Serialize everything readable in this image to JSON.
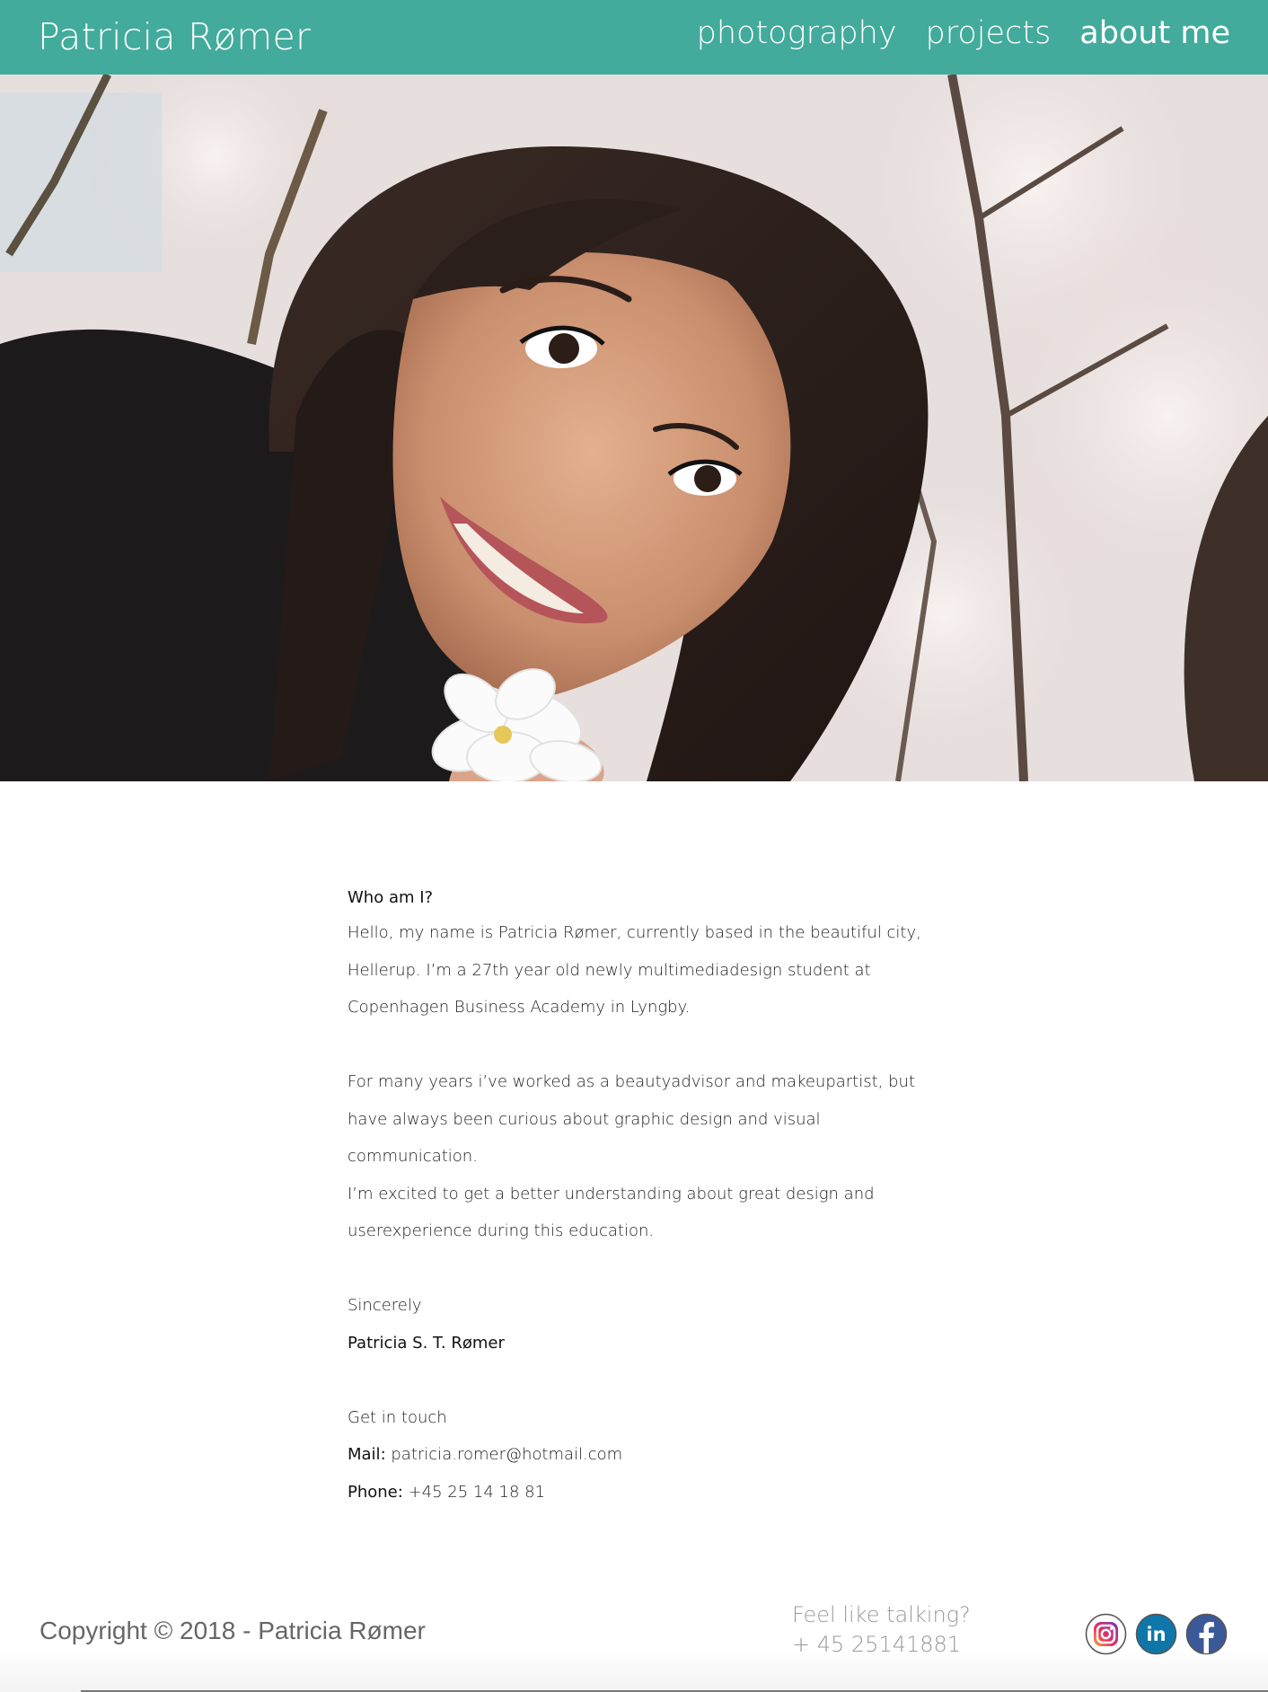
{
  "header": {
    "brand": "Patricia Rømer",
    "nav": [
      {
        "label": "photography",
        "active": false
      },
      {
        "label": "projects",
        "active": false
      },
      {
        "label": "about me",
        "active": true
      }
    ]
  },
  "hero": {
    "image": "portrait photo of smiling woman holding white cherry blossom under blooming trees"
  },
  "about": {
    "heading": "Who am I?",
    "intro": [
      "Hello, my name is Patricia Rømer, currently based in the beautiful city,",
      "Hellerup. I’m a 27th year old newly multimediadesign student at",
      "Copenhagen Business Academy in Lyngby."
    ],
    "experience": [
      "For many years i’ve worked as a beautyadvisor and makeupartist, but",
      "have always been curious about graphic design and visual",
      "communication.",
      "I’m excited to get a better understanding about great design and",
      "userexperience during this education."
    ],
    "closing": "Sincerely",
    "signature": "Patricia S. T. Rømer",
    "contact_title": "Get in touch",
    "mail_label": "Mail:",
    "mail_value": "patricia.romer@hotmail.com",
    "phone_label": "Phone:",
    "phone_value": "+45 25 14 18 81"
  },
  "footer": {
    "copyright": "Copyright © 2018 - Patricia Rømer",
    "talk_line1": "Feel like talking?",
    "talk_line2": "+ 45 25141881",
    "socials": [
      {
        "icon": "instagram-icon"
      },
      {
        "icon": "linkedin-icon"
      },
      {
        "icon": "facebook-icon"
      }
    ]
  },
  "colors": {
    "header_bg": "#42ab9c",
    "linkedin": "#0e76a8",
    "facebook": "#3b5998"
  }
}
